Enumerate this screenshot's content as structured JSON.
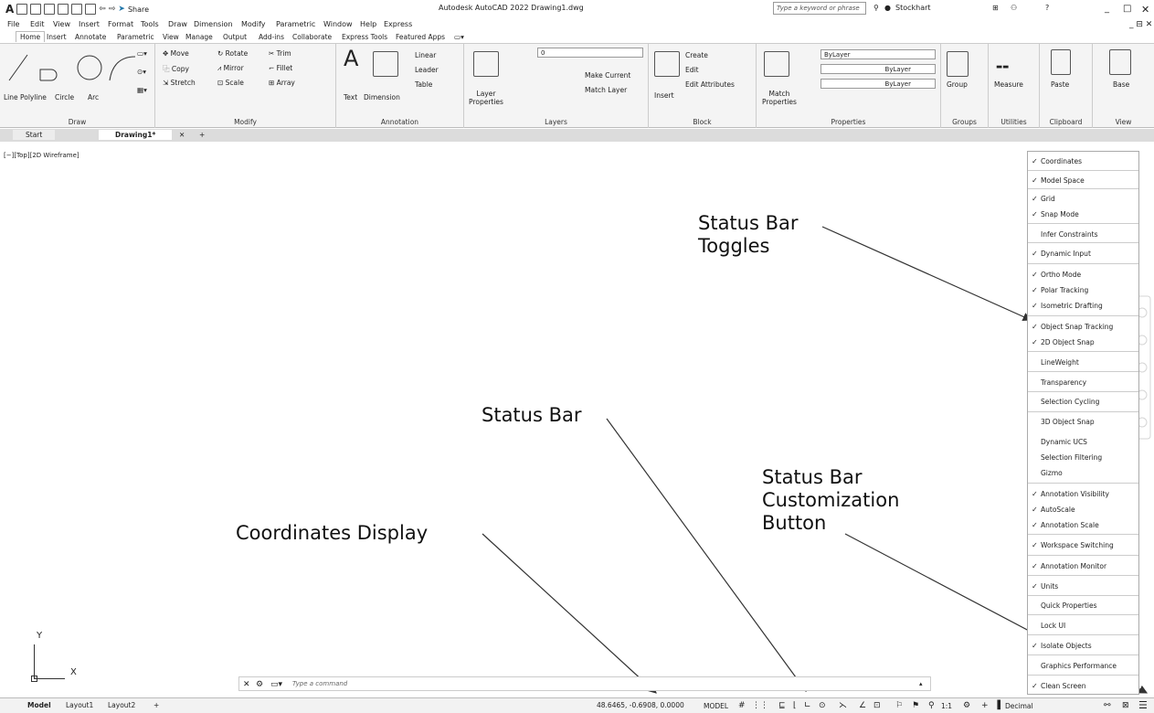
{
  "titlebar": {
    "app_title": "Autodesk AutoCAD 2022  Drawing1.dwg",
    "search_placeholder": "Type a keyword or phrase",
    "user": "Stockhart",
    "share": "Share",
    "logo": "A"
  },
  "menubar": [
    "File",
    "Edit",
    "View",
    "Insert",
    "Format",
    "Tools",
    "Draw",
    "Dimension",
    "Modify",
    "Parametric",
    "Window",
    "Help",
    "Express"
  ],
  "ribbon_tabs": [
    "Home",
    "Insert",
    "Annotate",
    "Parametric",
    "View",
    "Manage",
    "Output",
    "Add-ins",
    "Collaborate",
    "Express Tools",
    "Featured Apps"
  ],
  "ribbon": {
    "draw": {
      "title": "Draw",
      "items": [
        "Line",
        "Polyline",
        "Circle",
        "Arc"
      ]
    },
    "modify": {
      "title": "Modify",
      "items": [
        "Move",
        "Rotate",
        "Trim",
        "Copy",
        "Mirror",
        "Fillet",
        "Stretch",
        "Scale",
        "Array"
      ]
    },
    "annotation": {
      "title": "Annotation",
      "items": [
        "Text",
        "Dimension",
        "Linear",
        "Leader",
        "Table"
      ]
    },
    "layers": {
      "title": "Layers",
      "items": [
        "Layer Properties",
        "Make Current",
        "Match Layer"
      ],
      "layer_value": "0"
    },
    "block": {
      "title": "Block",
      "items": [
        "Insert",
        "Create",
        "Edit",
        "Edit Attributes"
      ]
    },
    "properties": {
      "title": "Properties",
      "items": [
        "Match Properties"
      ],
      "dropdowns": [
        "ByLayer",
        "ByLayer",
        "ByLayer"
      ]
    },
    "groups": {
      "title": "Groups",
      "items": [
        "Group"
      ]
    },
    "utilities": {
      "title": "Utilities",
      "items": [
        "Measure"
      ]
    },
    "clipboard": {
      "title": "Clipboard",
      "items": [
        "Paste"
      ]
    },
    "view": {
      "title": "View",
      "items": [
        "Base"
      ]
    }
  },
  "doc_tabs": [
    "Start",
    "Drawing1*"
  ],
  "viewport_label": "[−][Top][2D Wireframe]",
  "annotations": {
    "status_bar_toggles": "Status Bar Toggles",
    "status_bar": "Status Bar",
    "status_bar_customization": "Status Bar Customization Button",
    "coordinates_display": "Coordinates Display"
  },
  "command_placeholder": "Type a command",
  "layout_tabs": [
    "Model",
    "Layout1",
    "Layout2"
  ],
  "statusbar": {
    "coordinates": "48.6465, -0.6908, 0.0000",
    "model": "MODEL",
    "scale": "1:1",
    "units": "Decimal"
  },
  "customization_menu": [
    {
      "label": "Coordinates",
      "checked": true
    },
    {
      "label": "Model Space",
      "checked": true
    },
    {
      "label": "Grid",
      "checked": true
    },
    {
      "label": "Snap Mode",
      "checked": true
    },
    {
      "label": "Infer Constraints",
      "checked": false
    },
    {
      "label": "Dynamic Input",
      "checked": true
    },
    {
      "label": "Ortho Mode",
      "checked": true
    },
    {
      "label": "Polar Tracking",
      "checked": true
    },
    {
      "label": "Isometric Drafting",
      "checked": true
    },
    {
      "label": "Object Snap Tracking",
      "checked": true
    },
    {
      "label": "2D Object Snap",
      "checked": true
    },
    {
      "label": "LineWeight",
      "checked": false
    },
    {
      "label": "Transparency",
      "checked": false
    },
    {
      "label": "Selection Cycling",
      "checked": false
    },
    {
      "label": "3D Object Snap",
      "checked": false
    },
    {
      "label": "Dynamic UCS",
      "checked": false
    },
    {
      "label": "Selection Filtering",
      "checked": false
    },
    {
      "label": "Gizmo",
      "checked": false
    },
    {
      "label": "Annotation Visibility",
      "checked": true
    },
    {
      "label": "AutoScale",
      "checked": true
    },
    {
      "label": "Annotation Scale",
      "checked": true
    },
    {
      "label": "Workspace Switching",
      "checked": true
    },
    {
      "label": "Annotation Monitor",
      "checked": true
    },
    {
      "label": "Units",
      "checked": true
    },
    {
      "label": "Quick Properties",
      "checked": false
    },
    {
      "label": "Lock UI",
      "checked": false
    },
    {
      "label": "Isolate Objects",
      "checked": true
    },
    {
      "label": "Graphics Performance",
      "checked": false
    },
    {
      "label": "Clean Screen",
      "checked": true
    }
  ],
  "ucs": {
    "x": "X",
    "y": "Y"
  }
}
